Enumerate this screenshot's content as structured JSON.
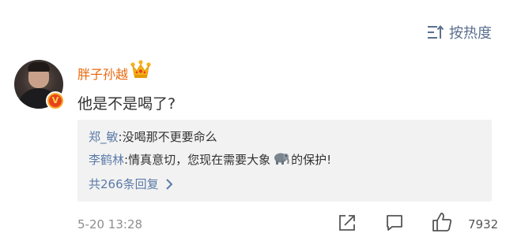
{
  "sort": {
    "label": "按热度",
    "icon": "sort-lines-icon"
  },
  "comment": {
    "username": "胖子孙越",
    "badge_icon": "crown-icon",
    "verified_icon": "v-verified-icon",
    "text": "他是不是喝了?",
    "timestamp": "5-20 13:28",
    "like_count": "7932"
  },
  "replies": {
    "items": [
      {
        "user": "郑_敏",
        "sep": ":",
        "text": "没喝那不更要命么"
      },
      {
        "user": "李鹤林",
        "sep": ":",
        "text_before": "情真意切，您现在需要大象",
        "emoji": "elephant-icon",
        "text_after": "的保护!"
      }
    ],
    "more_label": "共266条回复"
  },
  "colors": {
    "username": "#e86a10",
    "link": "#5b7aa8",
    "sort": "#5b6f8e",
    "reply_bg": "#f2f2f2",
    "muted": "#8e8e8e"
  }
}
